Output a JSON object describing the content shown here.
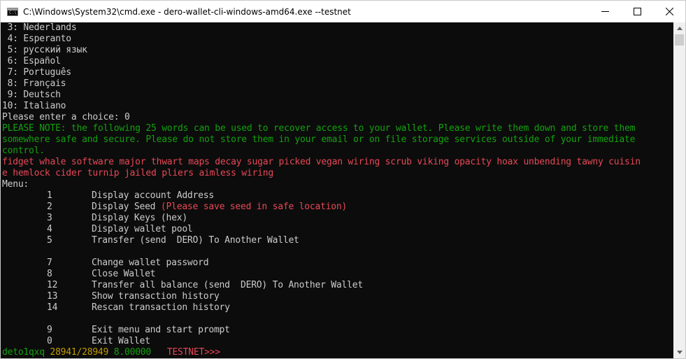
{
  "window": {
    "title": "C:\\Windows\\System32\\cmd.exe - dero-wallet-cli-windows-amd64.exe  --testnet",
    "icon_label": "C:\\"
  },
  "console": {
    "languages": [
      {
        "num": " 3:",
        "name": " Nederlands"
      },
      {
        "num": " 4:",
        "name": " Esperanto"
      },
      {
        "num": " 5:",
        "name": " русский язык"
      },
      {
        "num": " 6:",
        "name": " Español"
      },
      {
        "num": " 7:",
        "name": " Português"
      },
      {
        "num": " 8:",
        "name": " Français"
      },
      {
        "num": " 9:",
        "name": " Deutsch"
      },
      {
        "num": "10:",
        "name": " Italiano"
      }
    ],
    "choice_prompt": "Please enter a choice: 0",
    "note_lines": [
      "PLEASE NOTE: the following 25 words can be used to recover access to your wallet. Please write them down and store them",
      "somewhere safe and secure. Please do not store them in your email or on file storage services outside of your immediate",
      "control."
    ],
    "seed_lines": [
      "fidget whale software major thwart maps decay sugar picked vegan wiring scrub viking opacity hoax unbending tawny cuisin",
      "e hemlock cider turnip jailed pliers aimless wiring"
    ],
    "menu_title": "Menu:",
    "menu_items": [
      {
        "num": "1",
        "label": "Display account Address",
        "note": ""
      },
      {
        "num": "2",
        "label": "Display Seed ",
        "note": "(Please save seed in safe location)"
      },
      {
        "num": "3",
        "label": "Display Keys (hex)",
        "note": ""
      },
      {
        "num": "4",
        "label": "Display wallet pool",
        "note": ""
      },
      {
        "num": "5",
        "label": "Transfer (send  DERO) To Another Wallet",
        "note": ""
      },
      {
        "num": "",
        "label": "",
        "note": ""
      },
      {
        "num": "7",
        "label": "Change wallet password",
        "note": ""
      },
      {
        "num": "8",
        "label": "Close Wallet",
        "note": ""
      },
      {
        "num": "12",
        "label": "Transfer all balance (send  DERO) To Another Wallet",
        "note": ""
      },
      {
        "num": "13",
        "label": "Show transaction history",
        "note": ""
      },
      {
        "num": "14",
        "label": "Rescan transaction history",
        "note": ""
      },
      {
        "num": "",
        "label": "",
        "note": ""
      },
      {
        "num": "9",
        "label": "Exit menu and start prompt",
        "note": ""
      },
      {
        "num": "0",
        "label": "Exit Wallet",
        "note": ""
      }
    ],
    "prompt": {
      "address": "deto1qxq",
      "height": "28941/28949",
      "balance": "8.00000",
      "network": "TESTNET>>>"
    }
  },
  "colors": {
    "background": "#0c0c0c",
    "text": "#cccccc",
    "green": "#13a10e",
    "red": "#e74856",
    "yellow": "#c19c00"
  }
}
